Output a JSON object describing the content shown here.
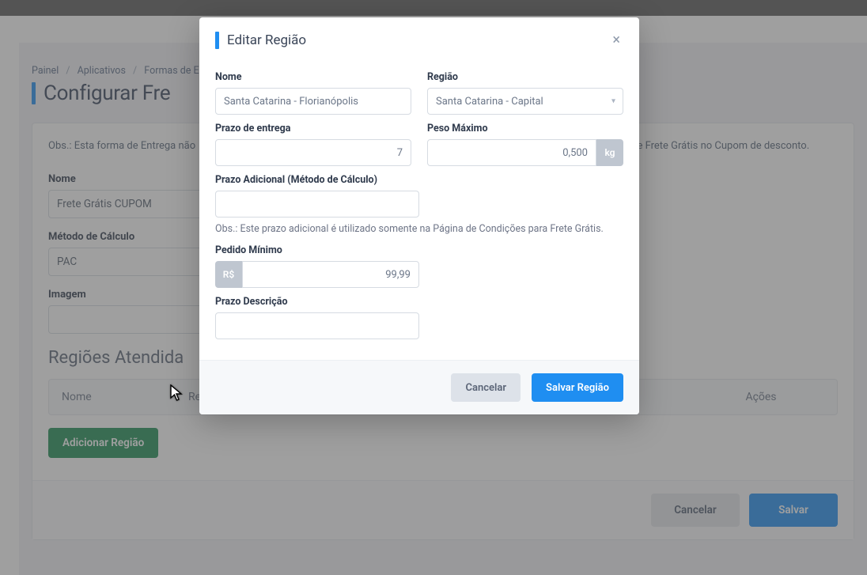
{
  "breadcrumb": {
    "painel": "Painel",
    "aplicativos": "Aplicativos",
    "formas_envio": "Formas de Envio"
  },
  "page": {
    "title_prefix": "Configurar Fre",
    "obs_prefix": "Obs.: Esta forma de Entrega não",
    "obs_suffix": "ção de Frete Grátis no Cupom de desconto.",
    "labels": {
      "nome": "Nome",
      "metodo": "Método de Cálculo",
      "imagem": "Imagem"
    },
    "values": {
      "nome": "Frete Grátis CUPOM",
      "metodo": "PAC",
      "imagem": ""
    },
    "section_regioes": "Regiões Atendida",
    "table": {
      "nome": "Nome",
      "regiao": "Re",
      "acoes": "Ações"
    },
    "buttons": {
      "adicionar": "Adicionar Região",
      "cancelar": "Cancelar",
      "salvar": "Salvar"
    }
  },
  "modal": {
    "title": "Editar Região",
    "labels": {
      "nome": "Nome",
      "regiao": "Região",
      "prazo_entrega": "Prazo de entrega",
      "peso_max": "Peso Máximo",
      "prazo_adicional": "Prazo Adicional (Método de Cálculo)",
      "prazo_adicional_obs": "Obs.: Este prazo adicional é utilizado somente na Página de Condições para Frete Grátis.",
      "pedido_minimo": "Pedido Mínimo",
      "prazo_descricao": "Prazo Descrição"
    },
    "values": {
      "nome": "Santa Catarina - Florianópolis",
      "regiao": "Santa Catarina - Capital",
      "prazo_entrega": "7",
      "peso_max": "0,500",
      "prazo_adicional": "",
      "pedido_minimo": "99,99",
      "prazo_descricao": ""
    },
    "addons": {
      "kg": "kg",
      "rs": "R$"
    },
    "buttons": {
      "cancelar": "Cancelar",
      "salvar": "Salvar Região"
    }
  }
}
